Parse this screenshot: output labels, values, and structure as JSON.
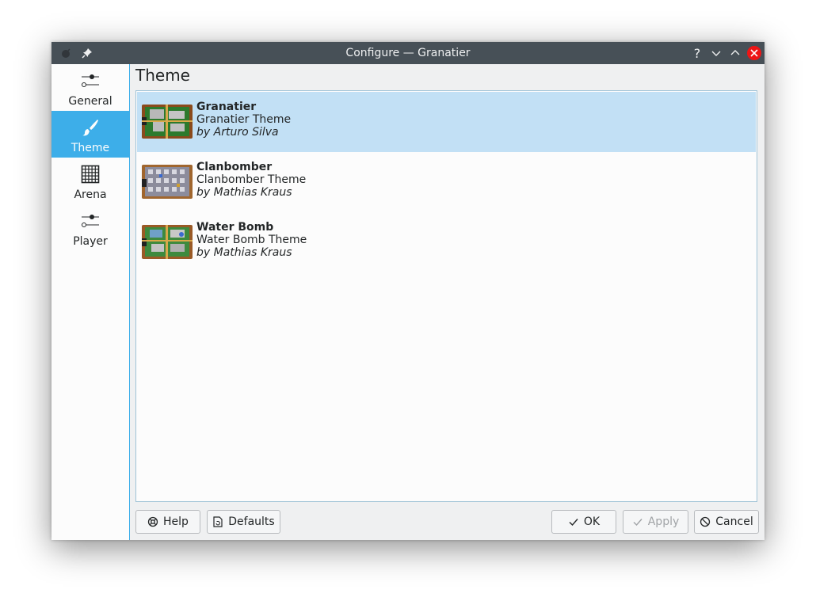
{
  "window": {
    "title": "Configure — Granatier",
    "buttons": {
      "help": "?"
    }
  },
  "sidebar": {
    "items": [
      {
        "label": "General",
        "icon": "sliders-icon",
        "active": false
      },
      {
        "label": "Theme",
        "icon": "brush-icon",
        "active": true
      },
      {
        "label": "Arena",
        "icon": "grid-icon",
        "active": false
      },
      {
        "label": "Player",
        "icon": "sliders-icon",
        "active": false
      }
    ]
  },
  "page": {
    "title": "Theme"
  },
  "themes": [
    {
      "name": "Granatier",
      "description": "Granatier Theme",
      "author": "by Arturo Silva",
      "selected": true
    },
    {
      "name": "Clanbomber",
      "description": "Clanbomber Theme",
      "author": "by Mathias Kraus",
      "selected": false
    },
    {
      "name": "Water Bomb",
      "description": "Water Bomb Theme",
      "author": "by Mathias Kraus",
      "selected": false
    }
  ],
  "footer": {
    "help_label": "Help",
    "defaults_label": "Defaults",
    "ok_label": "OK",
    "apply_label": "Apply",
    "cancel_label": "Cancel"
  },
  "colors": {
    "titlebar": "#475057",
    "accent": "#3daee9",
    "selection": "#c2e0f5",
    "close": "#ed1515"
  }
}
